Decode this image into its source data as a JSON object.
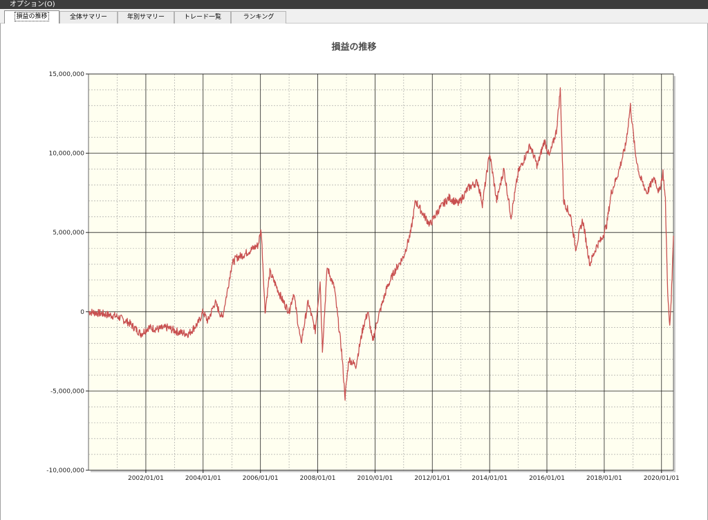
{
  "menu": {
    "options_label": "オプション(O)"
  },
  "tabs": [
    {
      "label": "損益の推移",
      "active": true
    },
    {
      "label": "全体サマリー",
      "active": false
    },
    {
      "label": "年別サマリー",
      "active": false
    },
    {
      "label": "トレード一覧",
      "active": false
    },
    {
      "label": "ランキング",
      "active": false
    }
  ],
  "colors": {
    "plot_background": "#fffff0",
    "line": "#c85050",
    "grid_major": "#222222",
    "grid_minor": "#9a9a9a"
  },
  "chart_data": {
    "type": "line",
    "title": "損益の推移",
    "xlabel": "",
    "ylabel": "",
    "ylim": [
      -10000000,
      15000000
    ],
    "xlim": [
      "2000/01/01",
      "2020/06/01"
    ],
    "y_ticks": [
      15000000,
      10000000,
      5000000,
      0,
      -5000000,
      -10000000
    ],
    "y_tick_labels": [
      "15,000,000",
      "10,000,000",
      "5,000,000",
      "0",
      "-5,000,000",
      "-10,000,000"
    ],
    "x_ticks": [
      "2002/01/01",
      "2004/01/01",
      "2006/01/01",
      "2008/01/01",
      "2010/01/01",
      "2012/01/01",
      "2014/01/01",
      "2016/01/01",
      "2018/01/01",
      "2020/01/01"
    ],
    "grid": true,
    "series": [
      {
        "points": [
          [
            "2000/01/01",
            0
          ],
          [
            "2000/06/01",
            -100000
          ],
          [
            "2001/01/01",
            -300000
          ],
          [
            "2001/06/01",
            -700000
          ],
          [
            "2001/11/01",
            -1400000
          ],
          [
            "2002/02/01",
            -1000000
          ],
          [
            "2002/06/01",
            -1100000
          ],
          [
            "2002/10/01",
            -1000000
          ],
          [
            "2003/03/01",
            -1300000
          ],
          [
            "2003/07/01",
            -1400000
          ],
          [
            "2003/11/01",
            -700000
          ],
          [
            "2004/01/01",
            0
          ],
          [
            "2004/03/01",
            -600000
          ],
          [
            "2004/06/01",
            600000
          ],
          [
            "2004/09/01",
            -400000
          ],
          [
            "2004/11/01",
            1200000
          ],
          [
            "2005/01/01",
            3000000
          ],
          [
            "2005/03/01",
            3400000
          ],
          [
            "2005/06/01",
            3600000
          ],
          [
            "2005/09/01",
            3900000
          ],
          [
            "2005/12/01",
            4200000
          ],
          [
            "2006/01/10",
            5200000
          ],
          [
            "2006/02/01",
            3000000
          ],
          [
            "2006/03/01",
            0
          ],
          [
            "2006/05/01",
            2500000
          ],
          [
            "2006/08/01",
            1500000
          ],
          [
            "2006/10/01",
            800000
          ],
          [
            "2007/01/01",
            0
          ],
          [
            "2007/03/01",
            1200000
          ],
          [
            "2007/06/01",
            -2000000
          ],
          [
            "2007/09/01",
            600000
          ],
          [
            "2007/12/01",
            -1200000
          ],
          [
            "2008/02/01",
            2000000
          ],
          [
            "2008/03/01",
            -2400000
          ],
          [
            "2008/05/01",
            2800000
          ],
          [
            "2008/08/01",
            1500000
          ],
          [
            "2008/11/01",
            -2500000
          ],
          [
            "2008/12/15",
            -5400000
          ],
          [
            "2009/02/01",
            -3000000
          ],
          [
            "2009/05/01",
            -3400000
          ],
          [
            "2009/08/01",
            -1000000
          ],
          [
            "2009/10/01",
            0
          ],
          [
            "2009/12/01",
            -1900000
          ],
          [
            "2010/02/01",
            -500000
          ],
          [
            "2010/06/01",
            1500000
          ],
          [
            "2010/09/01",
            2500000
          ],
          [
            "2011/01/01",
            3500000
          ],
          [
            "2011/04/01",
            5000000
          ],
          [
            "2011/06/01",
            7000000
          ],
          [
            "2011/09/01",
            6200000
          ],
          [
            "2011/12/01",
            5500000
          ],
          [
            "2012/04/01",
            6500000
          ],
          [
            "2012/08/01",
            7200000
          ],
          [
            "2012/12/01",
            6800000
          ],
          [
            "2013/04/01",
            7800000
          ],
          [
            "2013/08/01",
            8200000
          ],
          [
            "2013/10/01",
            6800000
          ],
          [
            "2014/01/01",
            10000000
          ],
          [
            "2014/04/01",
            7000000
          ],
          [
            "2014/07/01",
            9000000
          ],
          [
            "2014/10/01",
            6000000
          ],
          [
            "2015/01/01",
            8800000
          ],
          [
            "2015/06/01",
            10500000
          ],
          [
            "2015/09/01",
            9200000
          ],
          [
            "2015/12/01",
            10800000
          ],
          [
            "2016/02/01",
            9800000
          ],
          [
            "2016/05/01",
            11400000
          ],
          [
            "2016/06/20",
            14000000
          ],
          [
            "2016/08/01",
            7000000
          ],
          [
            "2016/11/01",
            6000000
          ],
          [
            "2017/01/01",
            4000000
          ],
          [
            "2017/04/01",
            5800000
          ],
          [
            "2017/07/01",
            3000000
          ],
          [
            "2017/10/01",
            4200000
          ],
          [
            "2017/12/01",
            4600000
          ],
          [
            "2018/02/01",
            5500000
          ],
          [
            "2018/04/01",
            7500000
          ],
          [
            "2018/07/01",
            8800000
          ],
          [
            "2018/10/01",
            10500000
          ],
          [
            "2018/12/01",
            13000000
          ],
          [
            "2019/02/01",
            10000000
          ],
          [
            "2019/04/01",
            8500000
          ],
          [
            "2019/07/01",
            7500000
          ],
          [
            "2019/10/01",
            8500000
          ],
          [
            "2019/12/01",
            7500000
          ],
          [
            "2020/01/20",
            8800000
          ],
          [
            "2020/02/20",
            7000000
          ],
          [
            "2020/03/10",
            3000000
          ],
          [
            "2020/03/25",
            600000
          ],
          [
            "2020/04/15",
            -1000000
          ],
          [
            "2020/05/10",
            1500000
          ],
          [
            "2020/06/01",
            4800000
          ]
        ]
      }
    ]
  }
}
